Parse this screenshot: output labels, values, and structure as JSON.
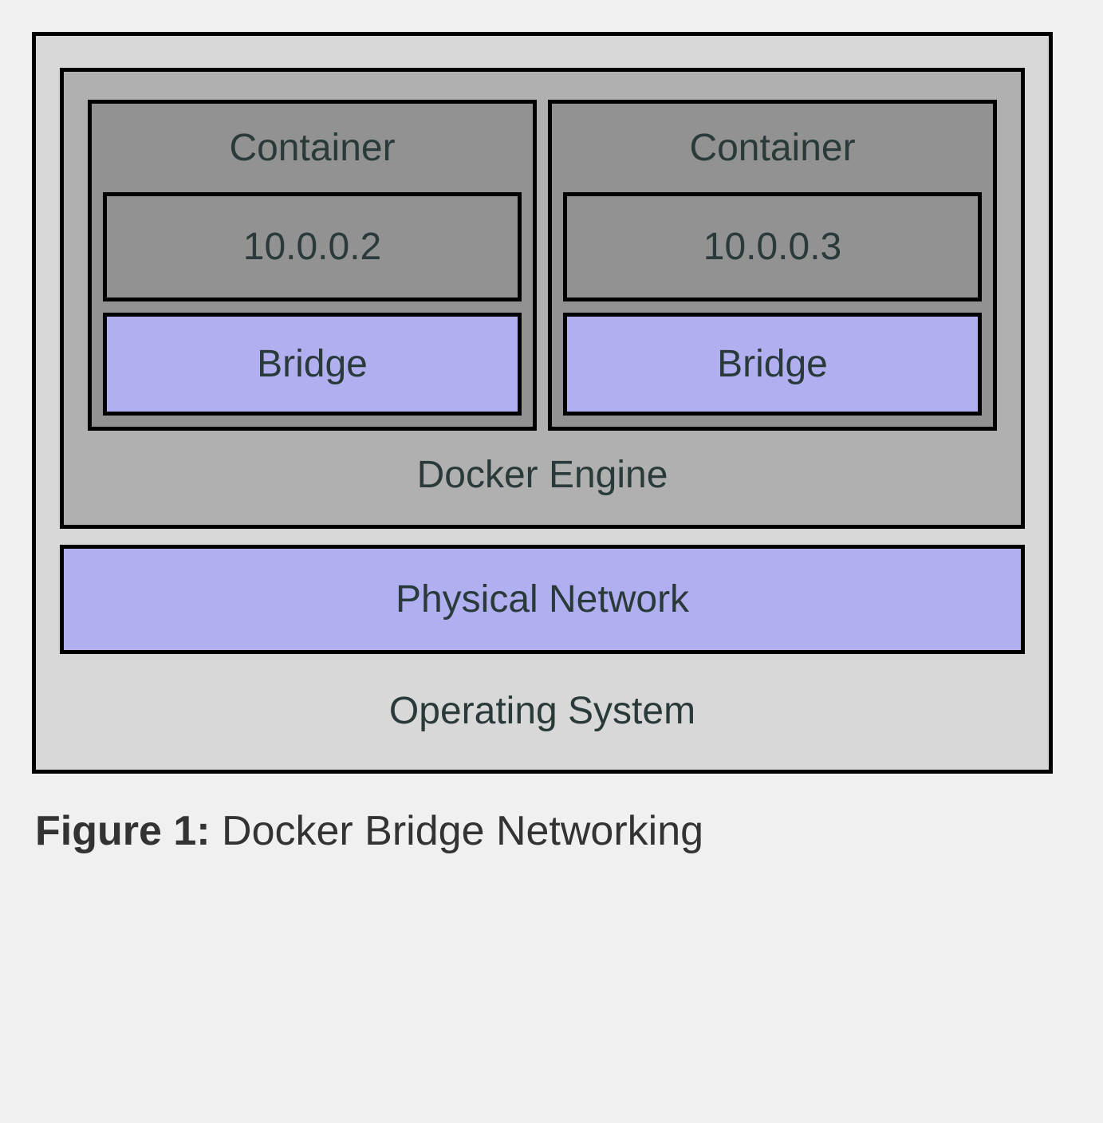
{
  "diagram": {
    "os_label": "Operating System",
    "engine_label": "Docker Engine",
    "physical_network_label": "Physical Network",
    "containers": [
      {
        "title": "Container",
        "ip": "10.0.0.2",
        "bridge_label": "Bridge"
      },
      {
        "title": "Container",
        "ip": "10.0.0.3",
        "bridge_label": "Bridge"
      }
    ]
  },
  "caption": {
    "figure_label": "Figure 1:",
    "text": " Docker Bridge Networking"
  },
  "colors": {
    "os_bg": "#d8d8d8",
    "engine_bg": "#b0b0b0",
    "container_bg": "#929292",
    "accent_purple": "#b0b0f0",
    "border": "#000000",
    "text": "#2a3a3a"
  }
}
